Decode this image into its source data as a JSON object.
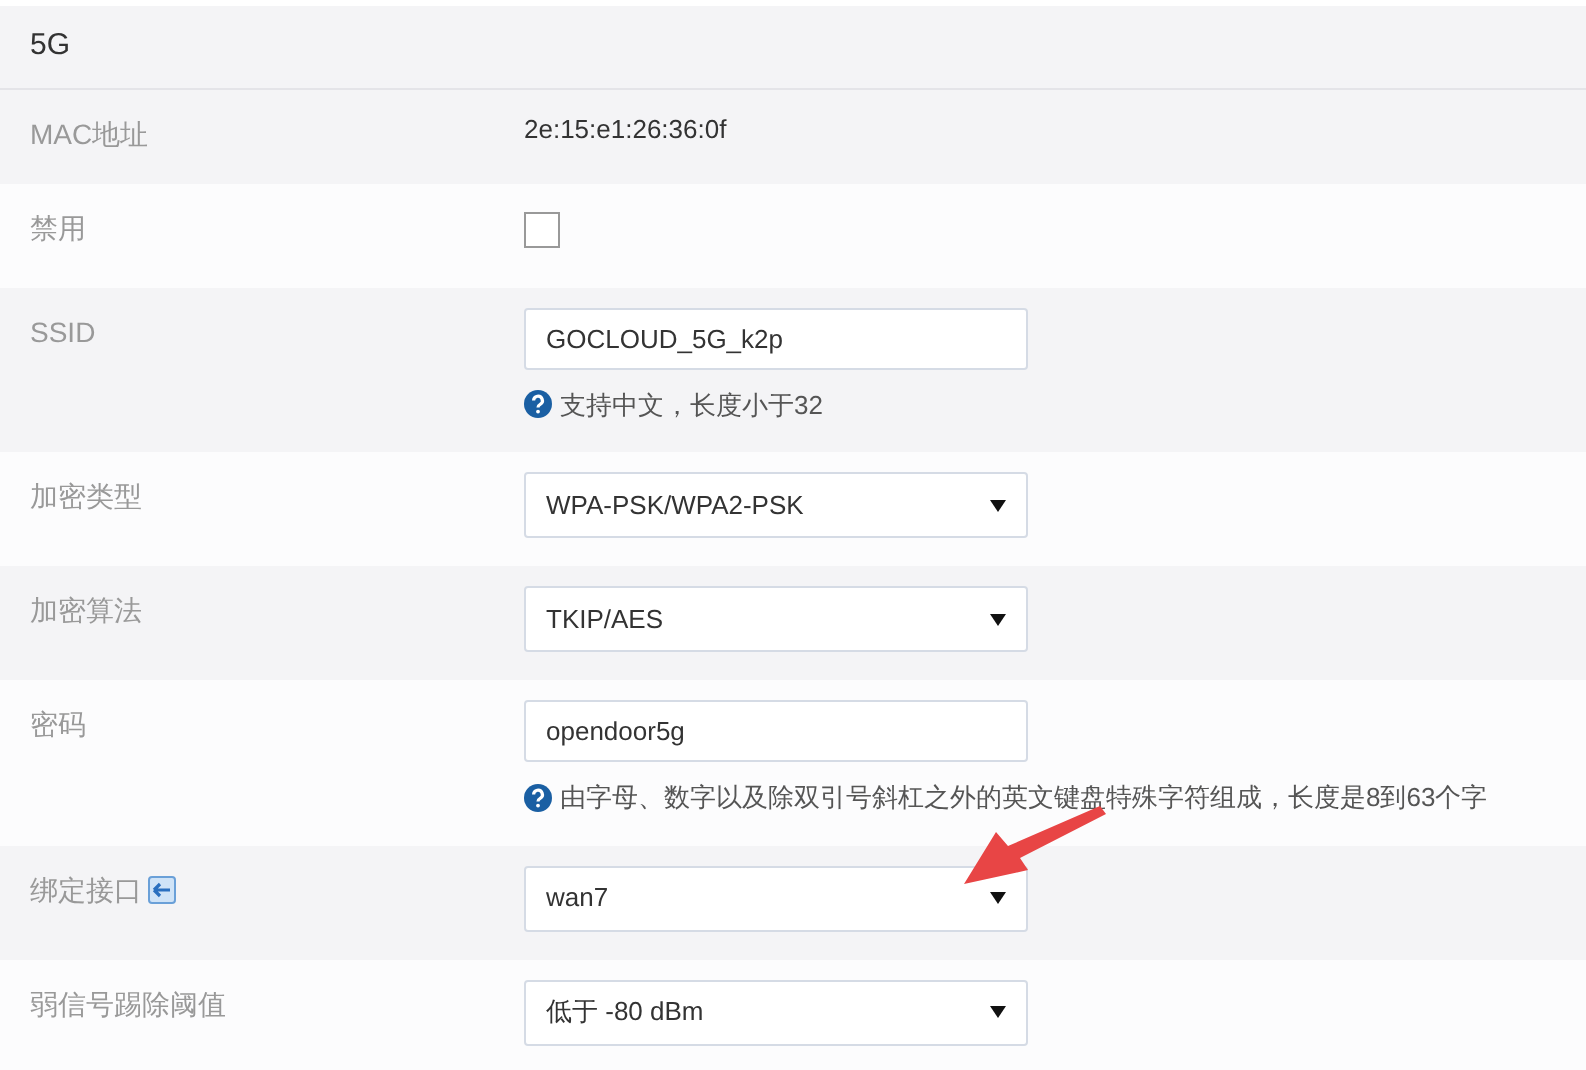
{
  "section": {
    "title": "5G"
  },
  "rows": [
    {
      "label": "MAC地址",
      "kind": "text",
      "value": "2e:15:e1:26:36:0f"
    },
    {
      "label": "禁用",
      "kind": "checkbox",
      "checked": false
    },
    {
      "label": "SSID",
      "kind": "input",
      "value": "GOCLOUD_5G_k2p",
      "hint": "支持中文，长度小于32"
    },
    {
      "label": "加密类型",
      "kind": "select",
      "value": "WPA-PSK/WPA2-PSK"
    },
    {
      "label": "加密算法",
      "kind": "select",
      "value": "TKIP/AES"
    },
    {
      "label": "密码",
      "kind": "input",
      "value": "opendoor5g",
      "hint": "由字母、数字以及除双引号斜杠之外的英文键盘特殊字符组成，长度是8到63个字"
    },
    {
      "label": "绑定接口",
      "kind": "select",
      "value": "wan7",
      "label_icon": true
    },
    {
      "label": "弱信号踢除阈值",
      "kind": "select",
      "value": "低于 -80 dBm"
    }
  ]
}
